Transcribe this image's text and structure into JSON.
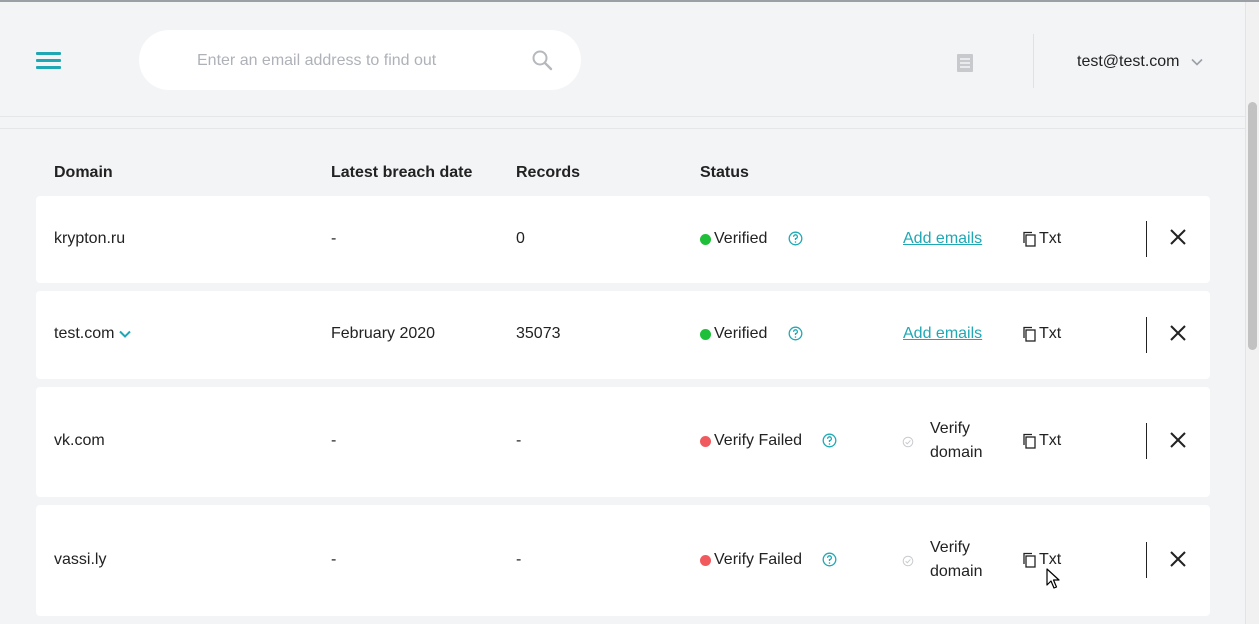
{
  "header": {
    "search": {
      "placeholder": "Enter an email address to find out",
      "value": ""
    },
    "user": {
      "email": "test@test.com"
    }
  },
  "table": {
    "columns": [
      "Domain",
      "Latest breach date",
      "Records",
      "Status"
    ],
    "rows": [
      {
        "domain": "krypton.ru",
        "date": "-",
        "records": "0",
        "status": "Verified",
        "action": "Add emails",
        "copy": "Txt"
      },
      {
        "domain": "test.com",
        "date": "February 2020",
        "records": "35073",
        "status": "Verified",
        "action": "Add emails",
        "copy": "Txt"
      },
      {
        "domain": "vk.com",
        "date": "-",
        "records": "-",
        "status": "Verify Failed",
        "action_line1": "Verify",
        "action_line2": "domain",
        "copy": "Txt"
      },
      {
        "domain": "vassi.ly",
        "date": "-",
        "records": "-",
        "status": "Verify Failed",
        "action_line1": "Verify",
        "action_line2": "domain",
        "copy": "Txt"
      }
    ]
  },
  "icons": {
    "menu": "hamburger-icon",
    "search": "search-icon",
    "document": "document-icon",
    "user_dropdown": "chevron-down-icon",
    "help": "question-circle-icon",
    "copy": "copy-icon",
    "close": "close-icon",
    "verify": "check-circle-icon"
  },
  "colors": {
    "accent": "#1fa8b4",
    "verified": "#1fbf3a",
    "failed": "#f05a5e",
    "background": "#f3f4f6"
  }
}
